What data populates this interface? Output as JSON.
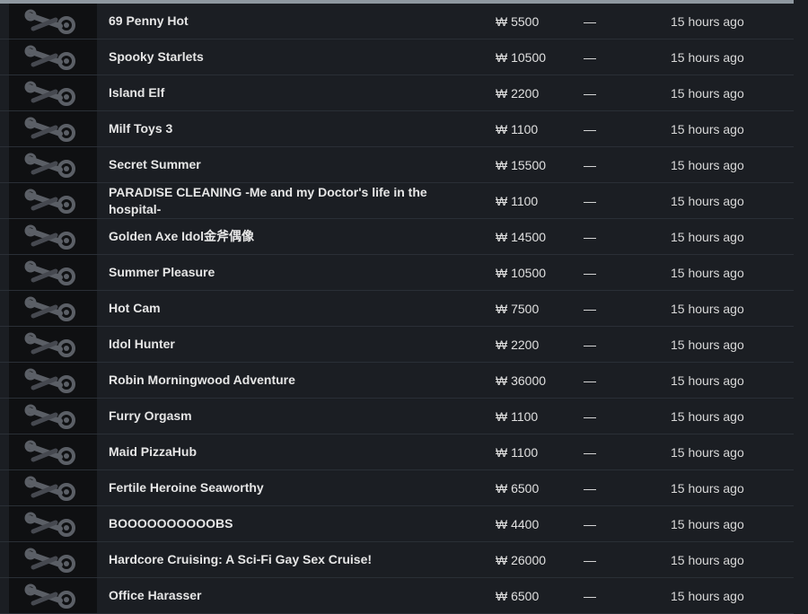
{
  "rows": [
    {
      "name": "69 Penny Hot",
      "price": "₩ 5500",
      "discount": "—",
      "updated": "15 hours ago",
      "icon": "steam-logo-icon"
    },
    {
      "name": "Spooky Starlets",
      "price": "₩ 10500",
      "discount": "—",
      "updated": "15 hours ago",
      "icon": "steam-logo-icon"
    },
    {
      "name": "Island Elf",
      "price": "₩ 2200",
      "discount": "—",
      "updated": "15 hours ago",
      "icon": "steam-logo-icon"
    },
    {
      "name": "Milf Toys 3",
      "price": "₩ 1100",
      "discount": "—",
      "updated": "15 hours ago",
      "icon": "steam-logo-icon"
    },
    {
      "name": "Secret Summer",
      "price": "₩ 15500",
      "discount": "—",
      "updated": "15 hours ago",
      "icon": "steam-logo-icon"
    },
    {
      "name": "PARADISE CLEANING -Me and my Doctor's life in the hospital-",
      "price": "₩ 1100",
      "discount": "—",
      "updated": "15 hours ago",
      "icon": "steam-logo-icon"
    },
    {
      "name": "Golden Axe Idol金斧偶像",
      "price": "₩ 14500",
      "discount": "—",
      "updated": "15 hours ago",
      "icon": "steam-logo-icon"
    },
    {
      "name": "Summer Pleasure",
      "price": "₩ 10500",
      "discount": "—",
      "updated": "15 hours ago",
      "icon": "steam-logo-icon"
    },
    {
      "name": "Hot Cam",
      "price": "₩ 7500",
      "discount": "—",
      "updated": "15 hours ago",
      "icon": "steam-logo-icon"
    },
    {
      "name": "Idol Hunter",
      "price": "₩ 2200",
      "discount": "—",
      "updated": "15 hours ago",
      "icon": "steam-logo-icon"
    },
    {
      "name": "Robin Morningwood Adventure",
      "price": "₩ 36000",
      "discount": "—",
      "updated": "15 hours ago",
      "icon": "steam-logo-icon"
    },
    {
      "name": "Furry Orgasm",
      "price": "₩ 1100",
      "discount": "—",
      "updated": "15 hours ago",
      "icon": "steam-logo-icon"
    },
    {
      "name": "Maid PizzaHub",
      "price": "₩ 1100",
      "discount": "—",
      "updated": "15 hours ago",
      "icon": "steam-logo-icon"
    },
    {
      "name": "Fertile Heroine Seaworthy",
      "price": "₩ 6500",
      "discount": "—",
      "updated": "15 hours ago",
      "icon": "steam-logo-icon"
    },
    {
      "name": "BOOOOOOOOOOBS",
      "price": "₩ 4400",
      "discount": "—",
      "updated": "15 hours ago",
      "icon": "steam-logo-icon"
    },
    {
      "name": "Hardcore Cruising: A Sci-Fi Gay Sex Cruise!",
      "price": "₩ 26000",
      "discount": "—",
      "updated": "15 hours ago",
      "icon": "steam-logo-icon"
    },
    {
      "name": "Office Harasser",
      "price": "₩ 6500",
      "discount": "—",
      "updated": "15 hours ago",
      "icon": "steam-logo-icon"
    }
  ]
}
